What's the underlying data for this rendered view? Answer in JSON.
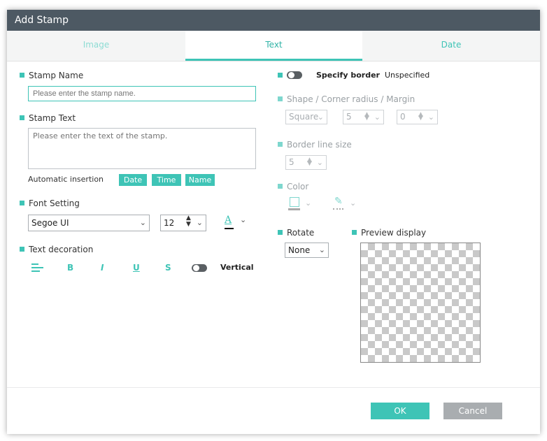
{
  "window": {
    "title": "Add Stamp"
  },
  "tabs": [
    {
      "label": "Image",
      "state": "disabled"
    },
    {
      "label": "Text",
      "state": "active"
    },
    {
      "label": "Date",
      "state": "normal"
    }
  ],
  "left": {
    "stamp_name": {
      "label": "Stamp Name",
      "placeholder": "Please enter the stamp name."
    },
    "stamp_text": {
      "label": "Stamp Text",
      "placeholder": "Please enter the text of the stamp."
    },
    "auto_insert": {
      "label": "Automatic insertion",
      "buttons": [
        "Date",
        "Time",
        "Name"
      ]
    },
    "font": {
      "label": "Font Setting",
      "family": "Segoe UI",
      "size": "12",
      "color_icon": "font-color-icon"
    },
    "decoration": {
      "label": "Text decoration",
      "align": "align-left-icon",
      "bold": "B",
      "italic": "I",
      "underline": "U",
      "strike": "S",
      "vertical_label": "Vertical",
      "vertical_on": false
    }
  },
  "right": {
    "border": {
      "label": "Specify border",
      "value": "Unspecified",
      "on": false
    },
    "shape": {
      "label": "Shape / Corner radius / Margin",
      "shape": "Square",
      "radius": "5",
      "margin": "0"
    },
    "line_size": {
      "label": "Border line size",
      "value": "5"
    },
    "color": {
      "label": "Color",
      "fill_icon": "fill-color-icon",
      "line_icon": "line-color-icon"
    },
    "rotate": {
      "label": "Rotate",
      "value": "None"
    },
    "preview": {
      "label": "Preview display"
    }
  },
  "footer": {
    "ok": "OK",
    "cancel": "Cancel"
  },
  "colors": {
    "accent": "#3ec4b6",
    "titlebar": "#4d5963",
    "cancel": "#a9adb0"
  }
}
